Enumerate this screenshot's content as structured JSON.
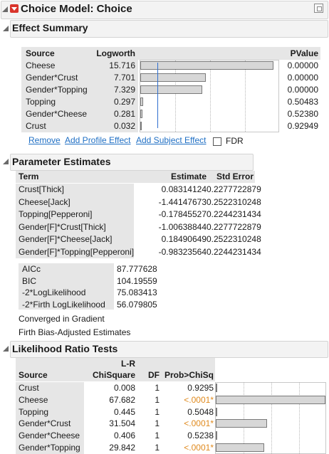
{
  "report": {
    "title": "Choice Model: Choice"
  },
  "effect_summary": {
    "title": "Effect Summary",
    "headers": {
      "source": "Source",
      "logworth": "Logworth",
      "pvalue": "PValue"
    },
    "rows": [
      {
        "source": "Cheese",
        "logworth": "15.716",
        "pvalue": "0.00000",
        "value": 15.716
      },
      {
        "source": "Gender*Crust",
        "logworth": "7.701",
        "pvalue": "0.00000",
        "value": 7.701
      },
      {
        "source": "Gender*Topping",
        "logworth": "7.329",
        "pvalue": "0.00000",
        "value": 7.329
      },
      {
        "source": "Topping",
        "logworth": "0.297",
        "pvalue": "0.50483",
        "value": 0.297
      },
      {
        "source": "Gender*Cheese",
        "logworth": "0.281",
        "pvalue": "0.52380",
        "value": 0.281
      },
      {
        "source": "Crust",
        "logworth": "0.032",
        "pvalue": "0.92949",
        "value": 0.032
      }
    ],
    "links": {
      "remove": "Remove",
      "add_profile": "Add Profile Effect",
      "add_subject": "Add Subject Effect"
    },
    "fdr_label": "FDR"
  },
  "parameter_estimates": {
    "title": "Parameter Estimates",
    "headers": {
      "term": "Term",
      "estimate": "Estimate",
      "std_error": "Std Error"
    },
    "rows": [
      {
        "term": "Crust[Thick]",
        "estimate": "0.08314124",
        "std_error": "0.2277722879"
      },
      {
        "term": "Cheese[Jack]",
        "estimate": "-1.44147673",
        "std_error": "0.2522310248"
      },
      {
        "term": "Topping[Pepperoni]",
        "estimate": "-0.17845527",
        "std_error": "0.2244231434"
      },
      {
        "term": "Gender[F]*Crust[Thick]",
        "estimate": "-1.00638844",
        "std_error": "0.2277722879"
      },
      {
        "term": "Gender[F]*Cheese[Jack]",
        "estimate": "0.18490649",
        "std_error": "0.2522310248"
      },
      {
        "term": "Gender[F]*Topping[Pepperoni]",
        "estimate": "-0.98323564",
        "std_error": "0.2244231434"
      }
    ],
    "fit_stats": [
      {
        "label": "AICc",
        "value": "87.777628"
      },
      {
        "label": "BIC",
        "value": "104.19559"
      },
      {
        "label": "-2*LogLikelihood",
        "value": "75.083413"
      },
      {
        "label": "-2*Firth LogLikelihood",
        "value": "56.079805"
      }
    ],
    "notes": [
      "Converged in Gradient",
      "Firth Bias-Adjusted Estimates"
    ]
  },
  "likelihood_ratio": {
    "title": "Likelihood Ratio Tests",
    "headers": {
      "source": "Source",
      "lr_top": "L-R",
      "lr_bottom": "ChiSquare",
      "df": "DF",
      "prob": "Prob>ChiSq"
    },
    "rows": [
      {
        "source": "Crust",
        "chisq": "0.008",
        "df": "1",
        "prob": "0.9295",
        "significant": false,
        "value": 0.008
      },
      {
        "source": "Cheese",
        "chisq": "67.682",
        "df": "1",
        "prob": "<.0001*",
        "significant": true,
        "value": 67.682
      },
      {
        "source": "Topping",
        "chisq": "0.445",
        "df": "1",
        "prob": "0.5048",
        "significant": false,
        "value": 0.445
      },
      {
        "source": "Gender*Crust",
        "chisq": "31.504",
        "df": "1",
        "prob": "<.0001*",
        "significant": true,
        "value": 31.504
      },
      {
        "source": "Gender*Cheese",
        "chisq": "0.406",
        "df": "1",
        "prob": "0.5238",
        "significant": false,
        "value": 0.406
      },
      {
        "source": "Gender*Topping",
        "chisq": "29.842",
        "df": "1",
        "prob": "<.0001*",
        "significant": true,
        "value": 29.842
      }
    ]
  },
  "colors": {
    "link": "#1f6fc4",
    "significant": "#e08a1e",
    "red_menu": "#d9342b",
    "ref_line": "#2f6fd0"
  }
}
